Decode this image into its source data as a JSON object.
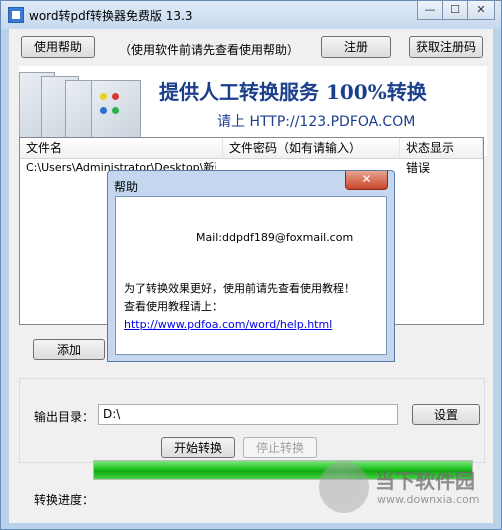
{
  "window": {
    "title": "word转pdf转换器免费版 13.3",
    "min": "—",
    "max": "☐",
    "close": "✕"
  },
  "toolbar": {
    "help_label": "使用帮助",
    "hint": "（使用软件前请先查看使用帮助）",
    "register_label": "注册",
    "get_code_label": "获取注册码"
  },
  "banner": {
    "headline": "提供人工转换服务 100%转换",
    "subline": "请上  HTTP://123.PDFOA.COM"
  },
  "file_list": {
    "columns": [
      "文件名",
      "文件密码（如有请输入）",
      "状态显示"
    ],
    "rows": [
      {
        "name": "C:\\Users\\Administrator\\Desktop\\新建",
        "password": "",
        "status": "错误"
      }
    ]
  },
  "add_label": "添加",
  "output": {
    "label": "输出目录：",
    "value": "D:\\",
    "settings_label": "设置"
  },
  "actions": {
    "start_label": "开始转换",
    "stop_label": "停止转换"
  },
  "progress": {
    "label": "转换进度：",
    "value": 1.0
  },
  "dialog": {
    "title": "帮助",
    "close": "✕",
    "mail": "Mail:ddpdf189@foxmail.com",
    "line1": "为了转换效果更好，使用前请先查看使用教程！",
    "line2": "查看使用教程请上：",
    "link": "http://www.pdfoa.com/word/help.html"
  },
  "watermark": {
    "brand": "当下软件园",
    "url": "www.downxia.com"
  }
}
